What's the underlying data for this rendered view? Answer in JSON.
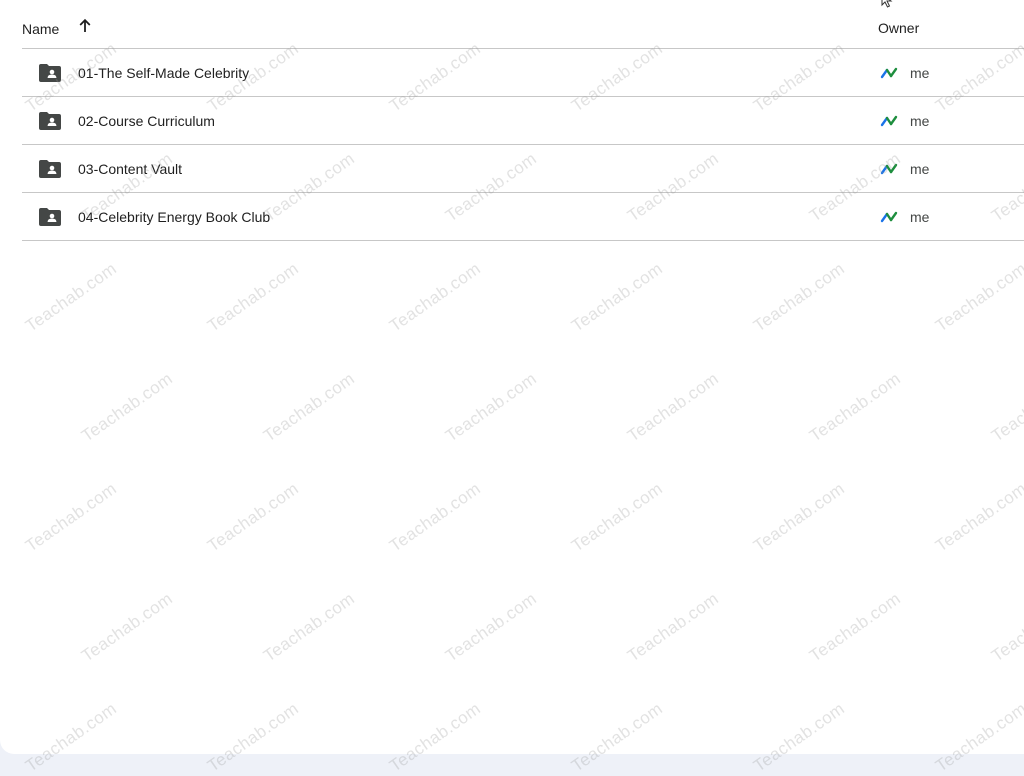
{
  "header": {
    "name_label": "Name",
    "owner_label": "Owner",
    "sort_icon": "arrow-upward-icon"
  },
  "rows": [
    {
      "name": "01-The Self-Made Celebrity",
      "owner": "me",
      "icon": "shared-folder-icon"
    },
    {
      "name": "02-Course Curriculum",
      "owner": "me",
      "icon": "shared-folder-icon"
    },
    {
      "name": "03-Content Vault",
      "owner": "me",
      "icon": "shared-folder-icon"
    },
    {
      "name": "04-Celebrity Energy Book Club",
      "owner": "me",
      "icon": "shared-folder-icon"
    }
  ],
  "watermark": {
    "text": "Teachab.com"
  },
  "colors": {
    "folder": "#444746",
    "divider": "#c7c7c7",
    "avatar_green": "#1e8e3e",
    "avatar_blue": "#1a73e8"
  }
}
